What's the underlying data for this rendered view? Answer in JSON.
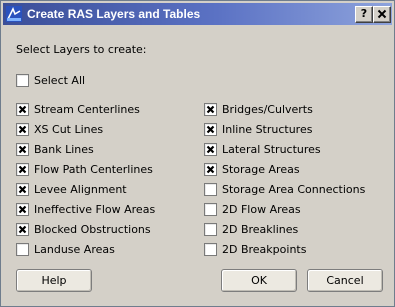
{
  "window": {
    "title": "Create RAS Layers and Tables",
    "help_glyph": "?",
    "close_glyph": "X"
  },
  "prompt": "Select Layers to create:",
  "select_all": {
    "label": "Select All",
    "checked": false
  },
  "left_column": [
    {
      "label": "Stream Centerlines",
      "checked": true
    },
    {
      "label": "XS Cut Lines",
      "checked": true
    },
    {
      "label": "Bank Lines",
      "checked": true
    },
    {
      "label": "Flow Path Centerlines",
      "checked": true
    },
    {
      "label": "Levee Alignment",
      "checked": true
    },
    {
      "label": "Ineffective Flow Areas",
      "checked": true
    },
    {
      "label": "Blocked Obstructions",
      "checked": true
    },
    {
      "label": "Landuse Areas",
      "checked": false
    }
  ],
  "right_column": [
    {
      "label": "Bridges/Culverts",
      "checked": true
    },
    {
      "label": "Inline Structures",
      "checked": true
    },
    {
      "label": "Lateral Structures",
      "checked": true
    },
    {
      "label": "Storage Areas",
      "checked": true
    },
    {
      "label": "Storage Area Connections",
      "checked": false
    },
    {
      "label": "2D Flow Areas",
      "checked": false
    },
    {
      "label": "2D Breaklines",
      "checked": false
    },
    {
      "label": "2D Breakpoints",
      "checked": false
    }
  ],
  "buttons": {
    "help": "Help",
    "ok": "OK",
    "cancel": "Cancel"
  },
  "icons": {
    "app": "ras-app-icon",
    "check": "check-x-icon"
  }
}
